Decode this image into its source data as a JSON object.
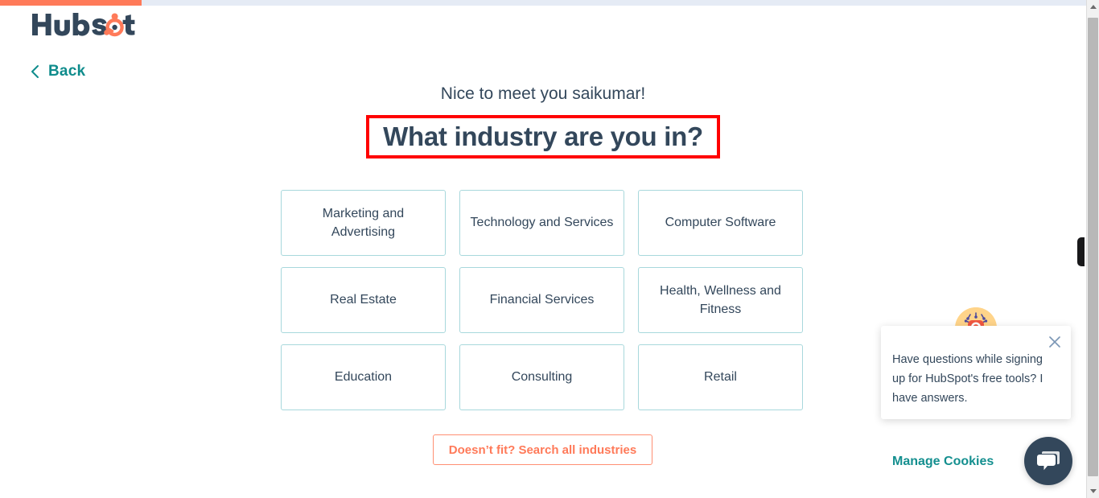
{
  "page": {
    "progress_percent": 13,
    "accent_orange": "#ff7a59",
    "brand_navy": "#33475b",
    "teal": "#0f8c8c",
    "highlight_red": "#ff0000",
    "card_border": "#a8d8dc"
  },
  "header": {
    "logo_text": "HubSpot",
    "logo_icon": "hubspot-logo-icon",
    "back_label": "Back",
    "back_icon": "chevron-left-icon"
  },
  "main": {
    "greeting": "Nice to meet you saikumar!",
    "headline": "What industry are you in?",
    "industries": [
      "Marketing and Advertising",
      "Technology and Services",
      "Computer Software",
      "Real Estate",
      "Financial Services",
      "Health, Wellness and Fitness",
      "Education",
      "Consulting",
      "Retail"
    ],
    "search_all_label": "Doesn’t fit? Search all industries"
  },
  "footer": {
    "manage_cookies_label": "Manage Cookies"
  },
  "chat": {
    "avatar_icon": "bot-avatar-icon",
    "message": "Have questions while signing up for HubSpot's free tools? I have answers.",
    "close_icon": "close-icon",
    "launcher_icon": "chat-bubbles-icon"
  },
  "scrollbar": {
    "up_icon": "scroll-up-arrow-icon",
    "down_icon": "scroll-down-arrow-icon"
  }
}
